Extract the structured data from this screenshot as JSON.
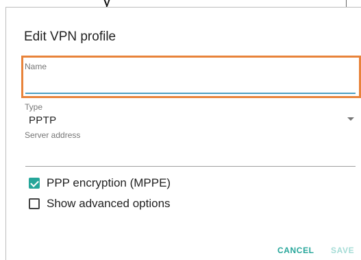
{
  "dialog": {
    "title": "Edit VPN profile",
    "fields": {
      "name": {
        "label": "Name",
        "value": ""
      },
      "type": {
        "label": "Type",
        "value": "PPTP"
      },
      "server_address": {
        "label": "Server address",
        "value": ""
      }
    },
    "checkboxes": [
      {
        "label": "PPP encryption (MPPE)",
        "checked": true
      },
      {
        "label": "Show advanced options",
        "checked": false
      }
    ],
    "buttons": {
      "cancel": "CANCEL",
      "save": "SAVE"
    }
  },
  "colors": {
    "accent": "#26a69a",
    "accent_disabled": "#a5dcd6",
    "focus_underline": "#4a9ec2",
    "highlight_box": "#e8833a"
  },
  "background_fragment": "y"
}
